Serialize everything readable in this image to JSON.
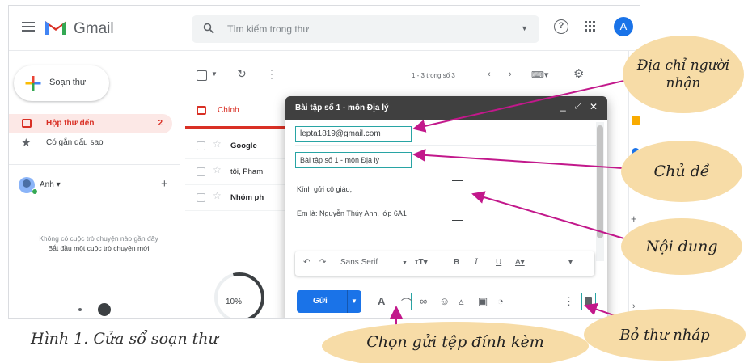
{
  "header": {
    "app_name": "Gmail",
    "search_placeholder": "Tìm kiếm trong thư",
    "help_glyph": "?",
    "avatar_initial": "A"
  },
  "sidebar": {
    "compose_label": "Soạn thư",
    "inbox_label": "Hộp thư đến",
    "inbox_count": "2",
    "starred_label": "Có gắn dấu sao",
    "hangouts_user": "Anh ▾",
    "empty_line1": "Không có cuộc trò chuyện nào gần đây",
    "empty_line2": "Bắt đầu một cuộc trò chuyện mới"
  },
  "toolbar": {
    "pager": "1 - 3 trong số 3"
  },
  "mail_list": {
    "tab_primary": "Chính",
    "rows": [
      {
        "sender": "Google",
        "bold": true
      },
      {
        "sender": "tôi, Pham",
        "bold": false
      },
      {
        "sender": "Nhóm ph",
        "bold": true
      }
    ],
    "progress_label": "10%"
  },
  "compose": {
    "title": "Bài tập số 1 - môn Địa lý",
    "to_value": "lepta1819@gmail.com",
    "subject_value": "Bài tập số 1 - môn Địa lý",
    "body_line1": "Kính gửi cô giáo,",
    "body_line2_prefix": "Em ",
    "body_line2_underlined1": "là",
    "body_line2_mid": ": Nguyễn Thúy Anh, lớp ",
    "body_line2_underlined2": "6A1",
    "font_name": "Sans Serif",
    "send_label": "Gửi"
  },
  "callouts": {
    "address": "Địa chỉ người nhận",
    "subject": "Chủ đề",
    "body": "Nội dung",
    "attach": "Chọn gửi tệp đính kèm",
    "delete": "Bỏ thư nháp"
  },
  "caption": "Hình 1. Cửa sổ soạn thư",
  "colors": {
    "accent_red": "#d93025",
    "highlight_teal": "#28a4a4",
    "arrow_magenta": "#c2188b",
    "callout_fill": "#f7dca7",
    "send_blue": "#1a73e8"
  }
}
